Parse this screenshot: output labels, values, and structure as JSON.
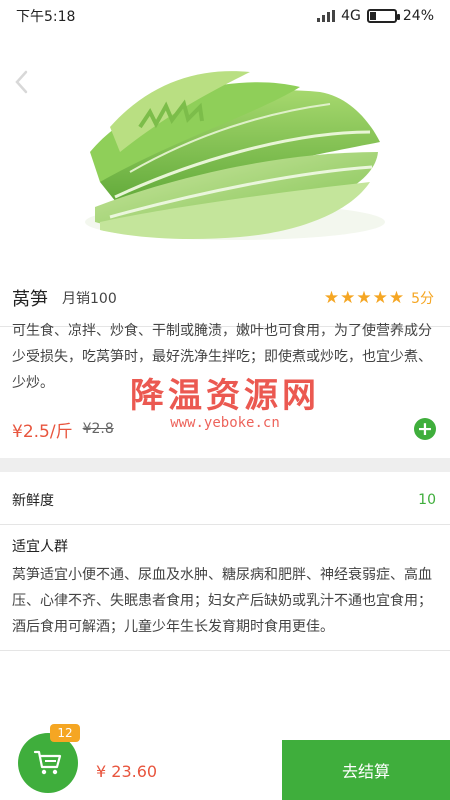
{
  "status_bar": {
    "time": "下午5:18",
    "network": "4G",
    "battery": "24%",
    "battery_level": 0.24
  },
  "header": {
    "back_icon": "chevron-left-icon"
  },
  "product": {
    "name": "莴笋",
    "monthly_sales": "月销100",
    "rating_stars": 5,
    "rating_text": "5分",
    "description": "可生食、凉拌、炒食、干制或腌渍，嫩叶也可食用，为了使营养成分少受损失，吃莴笋时，最好洗净生拌吃；即使煮或炒吃，也宜少煮、少炒。",
    "price": "¥2.5/斤",
    "old_price": "¥2.8",
    "add_icon": "plus-icon"
  },
  "watermark": {
    "title": "降温资源网",
    "url": "www.yeboke.cn"
  },
  "freshness": {
    "label": "新鲜度",
    "value": "10"
  },
  "suitable": {
    "title": "适宜人群",
    "text": "莴笋适宜小便不通、尿血及水肿、糖尿病和肥胖、神经衰弱症、高血压、心律不齐、失眠患者食用；妇女产后缺奶或乳汁不通也宜食用；酒后食用可解酒；儿童少年生长发育期时食用更佳。"
  },
  "cart": {
    "icon": "cart-icon",
    "count": "12",
    "total": "¥ 23.60",
    "checkout_label": "去结算"
  },
  "colors": {
    "accent_green": "#3fae3c",
    "price_red": "#e8553e",
    "star_orange": "#f5a623"
  }
}
